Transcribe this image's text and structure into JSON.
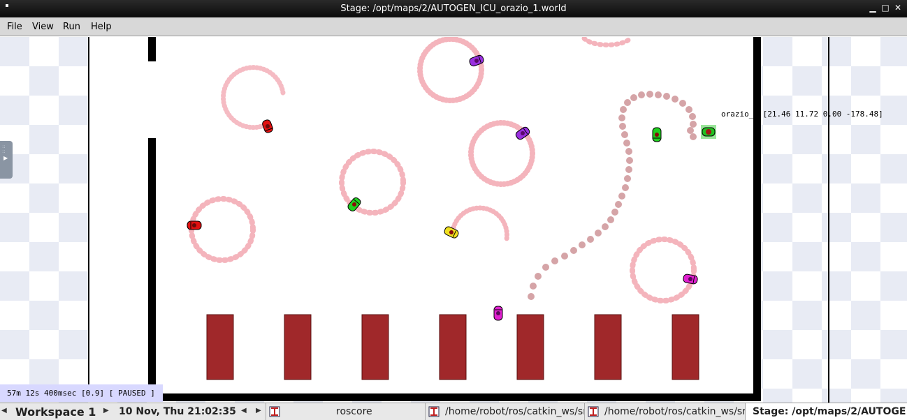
{
  "window": {
    "title": "Stage: /opt/maps/2/AUTOGEN_ICU_orazio_1.world",
    "sysmenu_icon": "menu-dot-icon",
    "buttons": [
      "minimize-icon",
      "maximize-icon",
      "close-icon"
    ]
  },
  "menu": {
    "file": "File",
    "view": "View",
    "run": "Run",
    "help": "Help"
  },
  "sim": {
    "status": "57m 12s 400msec [0.9] [ PAUSED ]",
    "robot_label": "orazio_0 [21.46 11.72 0.00 -178.48]"
  },
  "taskbar": {
    "workspace": "Workspace 1",
    "clock": "10 Nov, Thu 21:02:35",
    "tasks": [
      {
        "label": "roscore",
        "icon": "terminal-icon"
      },
      {
        "label": "/home/robot/ros/catkin_ws/sr",
        "icon": "terminal-icon"
      },
      {
        "label": "/home/robot/ros/catkin_ws/sr",
        "icon": "terminal-icon"
      },
      {
        "label": "Stage: /opt/maps/2/AUTOGE",
        "icon": ""
      }
    ]
  },
  "colors": {
    "bed": "#a0282a",
    "wall": "#000000",
    "trail": "#f4b4bc",
    "red": "#e01010",
    "purple": "#9a30e0",
    "green": "#20d020",
    "yellow": "#f0e020",
    "magenta": "#e020d0",
    "target": "#a01818",
    "selection": "#7fe07f"
  }
}
